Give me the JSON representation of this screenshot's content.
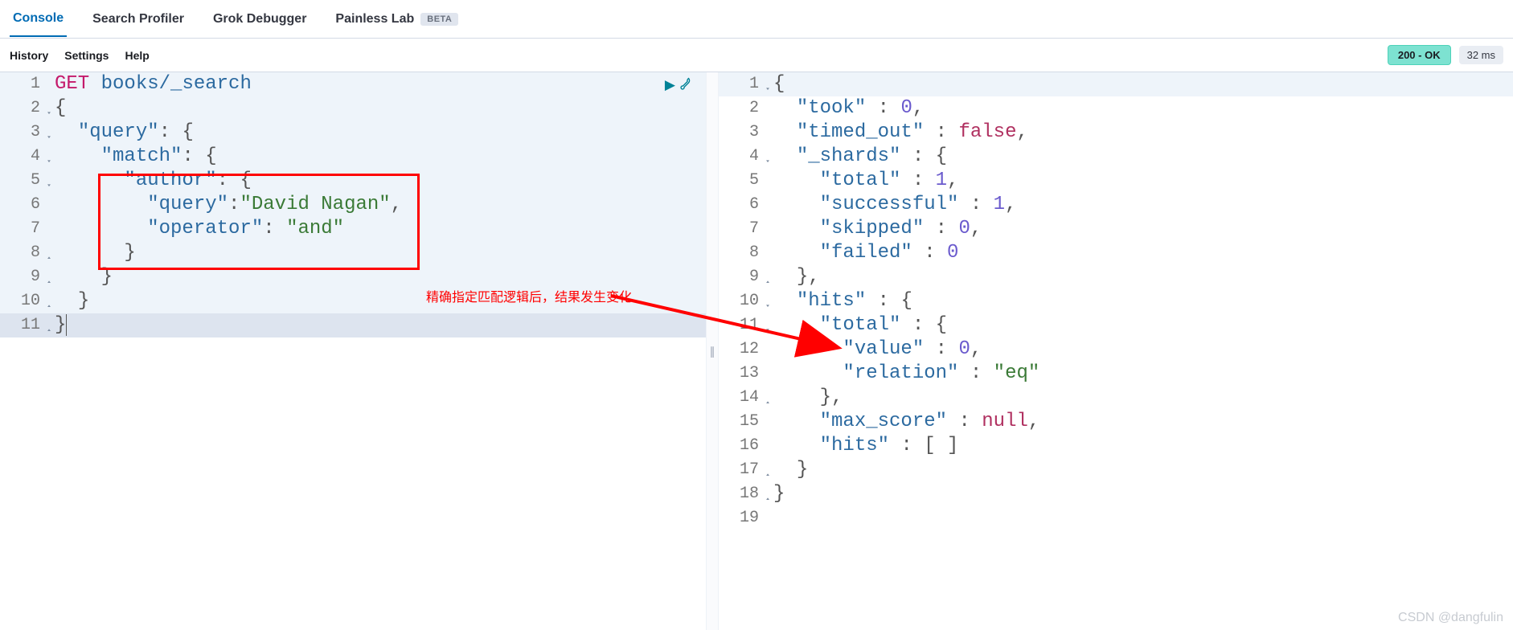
{
  "tabs": {
    "console": "Console",
    "search_profiler": "Search Profiler",
    "grok_debugger": "Grok Debugger",
    "painless_lab": "Painless Lab",
    "beta_label": "BETA"
  },
  "subnav": {
    "history": "History",
    "settings": "Settings",
    "help": "Help"
  },
  "status": {
    "code": "200 - OK",
    "time": "32 ms"
  },
  "request": {
    "lines": [
      {
        "n": "1",
        "fold": "",
        "hl": true,
        "html": "<span class='k-method'>GET</span> <span class='k-path'>books/_search</span>"
      },
      {
        "n": "2",
        "fold": "▾",
        "hl": true,
        "html": "<span class='k-punc'>{</span>"
      },
      {
        "n": "3",
        "fold": "▾",
        "hl": true,
        "html": "  <span class='k-key'>\"query\"</span><span class='k-punc'>:</span> <span class='k-punc'>{</span>"
      },
      {
        "n": "4",
        "fold": "▾",
        "hl": true,
        "html": "    <span class='k-key'>\"match\"</span><span class='k-punc'>:</span> <span class='k-punc'>{</span>"
      },
      {
        "n": "5",
        "fold": "▾",
        "hl": true,
        "html": "      <span class='k-key'>\"author\"</span><span class='k-punc'>:</span> <span class='k-punc'>{</span>"
      },
      {
        "n": "6",
        "fold": "",
        "hl": true,
        "html": "        <span class='k-key'>\"query\"</span><span class='k-punc'>:</span><span class='k-string'>\"David Nagan\"</span><span class='k-punc'>,</span>"
      },
      {
        "n": "7",
        "fold": "",
        "hl": true,
        "html": "        <span class='k-key'>\"operator\"</span><span class='k-punc'>:</span> <span class='k-string'>\"and\"</span>"
      },
      {
        "n": "8",
        "fold": "▴",
        "hl": true,
        "html": "      <span class='k-punc'>}</span>"
      },
      {
        "n": "9",
        "fold": "▴",
        "hl": true,
        "html": "    <span class='k-punc'>}</span>"
      },
      {
        "n": "10",
        "fold": "▴",
        "hl": true,
        "html": "  <span class='k-punc'>}</span>"
      },
      {
        "n": "11",
        "fold": "▴",
        "hl": false,
        "html": "<span class='k-punc'>}</span><span style='border-left:1px solid #555;'>&nbsp;</span>"
      }
    ]
  },
  "response": {
    "lines": [
      {
        "n": "1",
        "fold": "▾",
        "hl": true,
        "html": "<span class='k-punc'>{</span>"
      },
      {
        "n": "2",
        "fold": "",
        "hl": false,
        "html": "  <span class='k-key'>\"took\"</span> <span class='k-punc'>:</span> <span class='k-num'>0</span><span class='k-punc'>,</span>"
      },
      {
        "n": "3",
        "fold": "",
        "hl": false,
        "html": "  <span class='k-key'>\"timed_out\"</span> <span class='k-punc'>:</span> <span class='k-bool'>false</span><span class='k-punc'>,</span>"
      },
      {
        "n": "4",
        "fold": "▾",
        "hl": false,
        "html": "  <span class='k-key'>\"_shards\"</span> <span class='k-punc'>:</span> <span class='k-punc'>{</span>"
      },
      {
        "n": "5",
        "fold": "",
        "hl": false,
        "html": "    <span class='k-key'>\"total\"</span> <span class='k-punc'>:</span> <span class='k-num'>1</span><span class='k-punc'>,</span>"
      },
      {
        "n": "6",
        "fold": "",
        "hl": false,
        "html": "    <span class='k-key'>\"successful\"</span> <span class='k-punc'>:</span> <span class='k-num'>1</span><span class='k-punc'>,</span>"
      },
      {
        "n": "7",
        "fold": "",
        "hl": false,
        "html": "    <span class='k-key'>\"skipped\"</span> <span class='k-punc'>:</span> <span class='k-num'>0</span><span class='k-punc'>,</span>"
      },
      {
        "n": "8",
        "fold": "",
        "hl": false,
        "html": "    <span class='k-key'>\"failed\"</span> <span class='k-punc'>:</span> <span class='k-num'>0</span>"
      },
      {
        "n": "9",
        "fold": "▴",
        "hl": false,
        "html": "  <span class='k-punc'>},</span>"
      },
      {
        "n": "10",
        "fold": "▾",
        "hl": false,
        "html": "  <span class='k-key'>\"hits\"</span> <span class='k-punc'>:</span> <span class='k-punc'>{</span>"
      },
      {
        "n": "11",
        "fold": "▾",
        "hl": false,
        "html": "    <span class='k-key'>\"total\"</span> <span class='k-punc'>:</span> <span class='k-punc'>{</span>"
      },
      {
        "n": "12",
        "fold": "",
        "hl": false,
        "html": "      <span class='k-key'>\"value\"</span> <span class='k-punc'>:</span> <span class='k-num'>0</span><span class='k-punc'>,</span>"
      },
      {
        "n": "13",
        "fold": "",
        "hl": false,
        "html": "      <span class='k-key'>\"relation\"</span> <span class='k-punc'>:</span> <span class='k-string'>\"eq\"</span>"
      },
      {
        "n": "14",
        "fold": "▴",
        "hl": false,
        "html": "    <span class='k-punc'>},</span>"
      },
      {
        "n": "15",
        "fold": "",
        "hl": false,
        "html": "    <span class='k-key'>\"max_score\"</span> <span class='k-punc'>:</span> <span class='k-null'>null</span><span class='k-punc'>,</span>"
      },
      {
        "n": "16",
        "fold": "",
        "hl": false,
        "html": "    <span class='k-key'>\"hits\"</span> <span class='k-punc'>:</span> <span class='k-punc'>[ ]</span>"
      },
      {
        "n": "17",
        "fold": "▴",
        "hl": false,
        "html": "  <span class='k-punc'>}</span>"
      },
      {
        "n": "18",
        "fold": "▴",
        "hl": false,
        "html": "<span class='k-punc'>}</span>"
      },
      {
        "n": "19",
        "fold": "",
        "hl": false,
        "html": ""
      }
    ]
  },
  "annotation": {
    "text": "精确指定匹配逻辑后，结果发生变化"
  },
  "watermark": "CSDN @dangfulin"
}
